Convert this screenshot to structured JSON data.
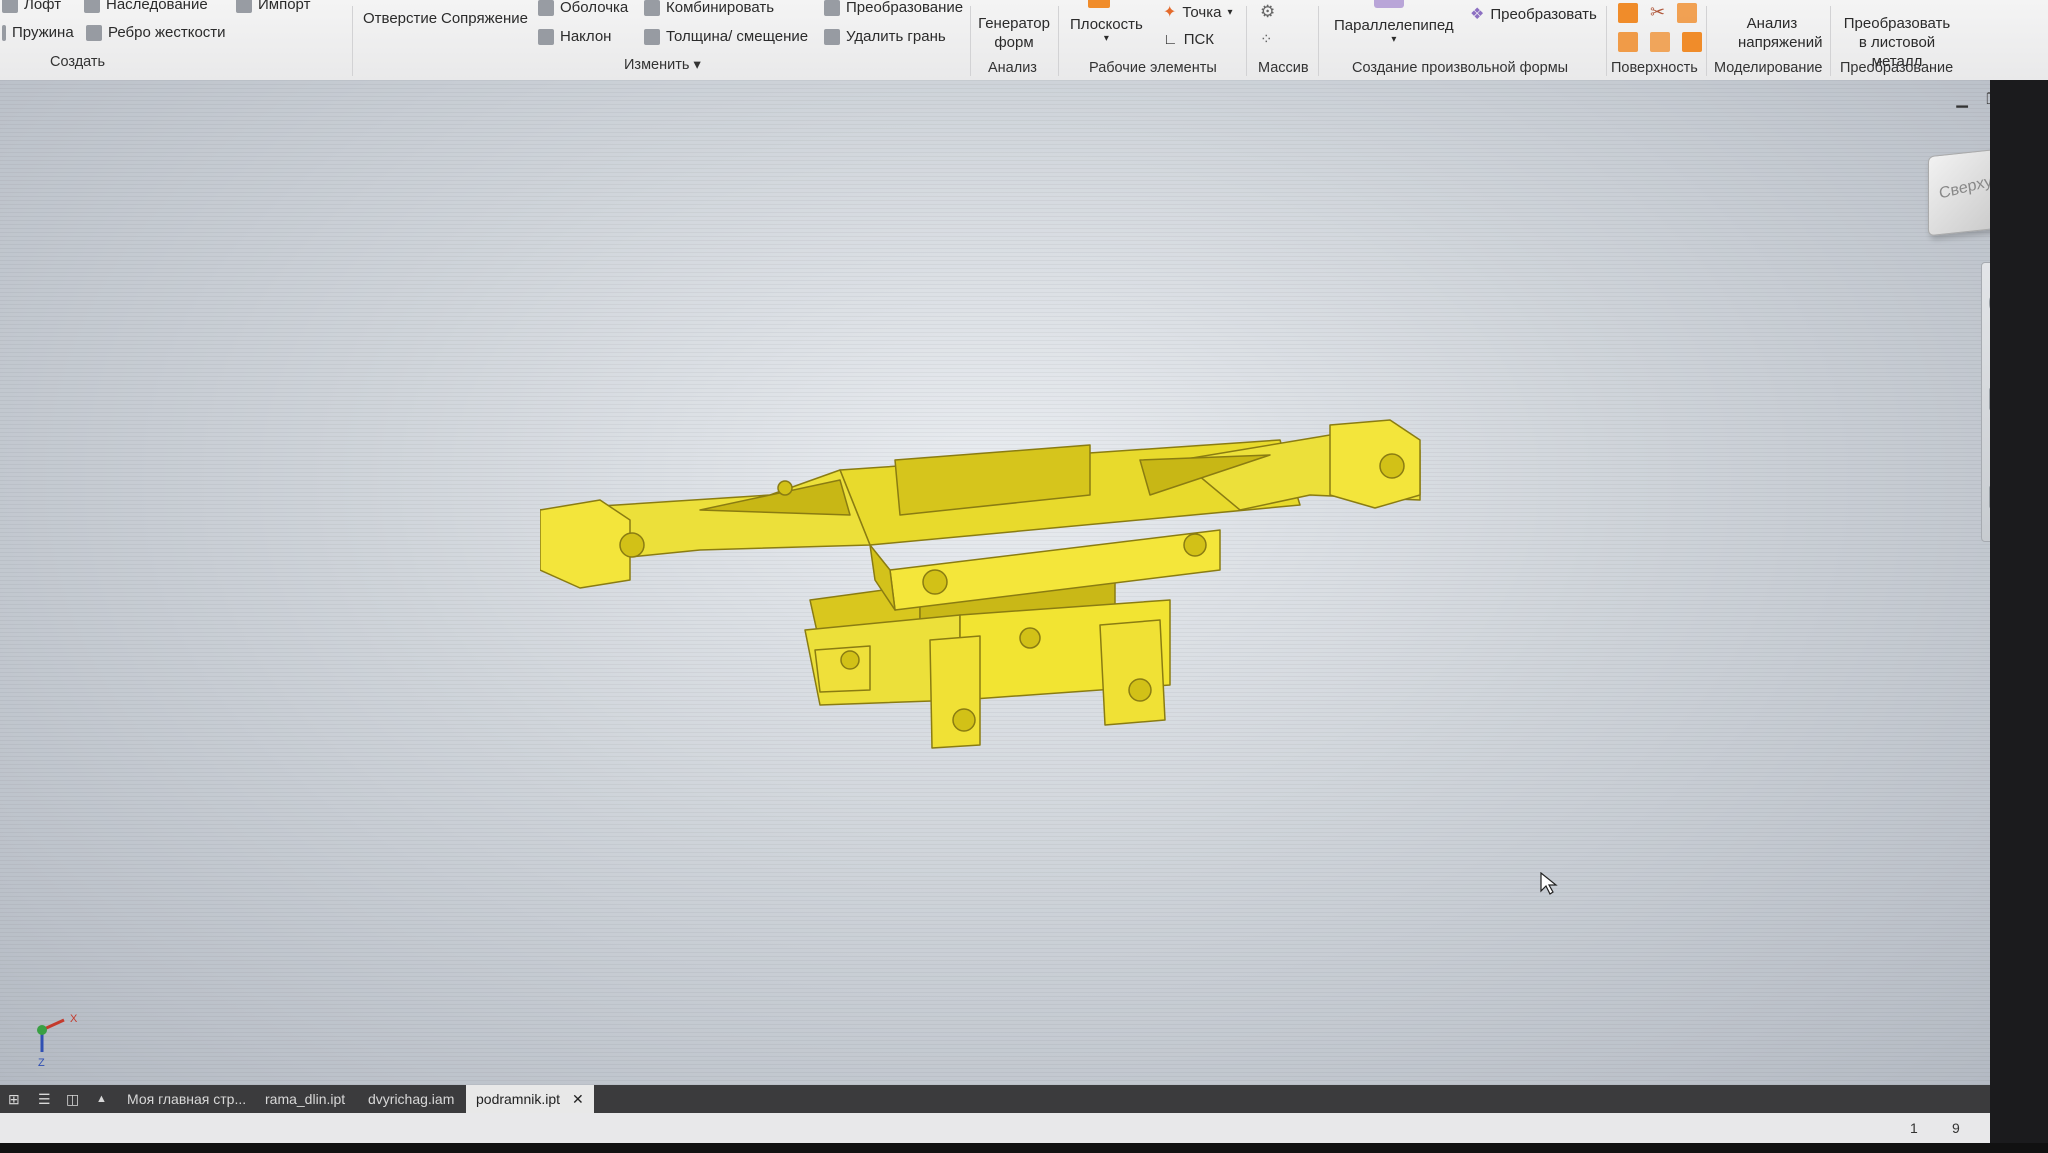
{
  "ribbon": {
    "create": {
      "loft": "Лофт",
      "inheritance": "Наследование",
      "import": "Импорт",
      "spring": "Пружина",
      "rib": "Ребро жесткости",
      "group": "Создать"
    },
    "hole": "Отверстие",
    "fillet": "Сопряжение",
    "modify": {
      "shell": "Оболочка",
      "combine": "Комбинировать",
      "transform": "Преобразование",
      "draft": "Наклон",
      "thicken": "Толщина/ смещение",
      "delete_face": "Удалить грань",
      "group": "Изменить"
    },
    "analysis": {
      "shape_gen": "Генератор форм",
      "group": "Анализ"
    },
    "work_features": {
      "plane": "Плоскость",
      "point": "Точка",
      "ucs": "ПСК",
      "group": "Рабочие элементы"
    },
    "pattern": {
      "group": "Массив"
    },
    "freeform": {
      "box": "Параллелепипед",
      "convert": "Преобразовать",
      "group": "Создание произвольной формы"
    },
    "surface": {
      "group": "Поверхность"
    },
    "simulation": {
      "stress": "Анализ напряжений",
      "group": "Моделирование"
    },
    "convert": {
      "sheet_metal": "Преобразовать в листовой металл",
      "group": "Преобразование"
    }
  },
  "viewcube": {
    "label": "Сверху"
  },
  "triad": {
    "x": "X",
    "z": "Z"
  },
  "tabs": [
    {
      "label": "Моя главная стр..."
    },
    {
      "label": "rama_dlin.ipt"
    },
    {
      "label": "dvyrichag.iam"
    },
    {
      "label": "podramnik.ipt",
      "active": true
    }
  ],
  "status": {
    "a": "1",
    "b": "9"
  },
  "colors": {
    "model": "#f2e432",
    "ribbon_bg": "#eeeeef",
    "tabbar": "#3b3b3d"
  }
}
